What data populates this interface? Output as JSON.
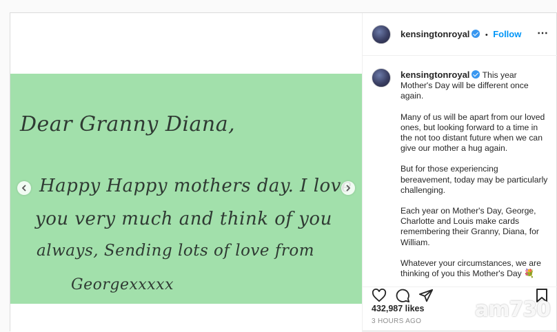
{
  "post": {
    "handwriting": {
      "line1": "Dear Granny Diana,",
      "line2": "Happy Happy mothers day. I love",
      "line3": "you very much and think of you",
      "line4": "always, Sending lots of love from",
      "line5": "Georgexxxxx"
    },
    "card_color": "#a2e0ab"
  },
  "header": {
    "username": "kensingtonroyal",
    "separator": "•",
    "follow_label": "Follow",
    "more_label": "⋯"
  },
  "caption": {
    "username": "kensingtonroyal",
    "first_text": "This year Mother's Day will be different once again.",
    "paragraphs": [
      "Many of us will be apart from our loved ones, but looking forward to a time in the not too distant future when we can give our mother a hug again.",
      "But for those experiencing bereavement, today may be particularly challenging.",
      "Each year on Mother's Day, George, Charlotte and Louis make cards remembering their Granny, Diana, for William.",
      "Whatever your circumstances, we are thinking of you this Mother's Day 💐"
    ]
  },
  "actions": {
    "likes": "432,987 likes",
    "time": "3 HOURS AGO",
    "icons": [
      "heart-icon",
      "comment-icon",
      "share-icon",
      "bookmark-icon"
    ]
  },
  "watermark": "am730",
  "colors": {
    "follow": "#0095f6",
    "verified": "#3897f0"
  }
}
